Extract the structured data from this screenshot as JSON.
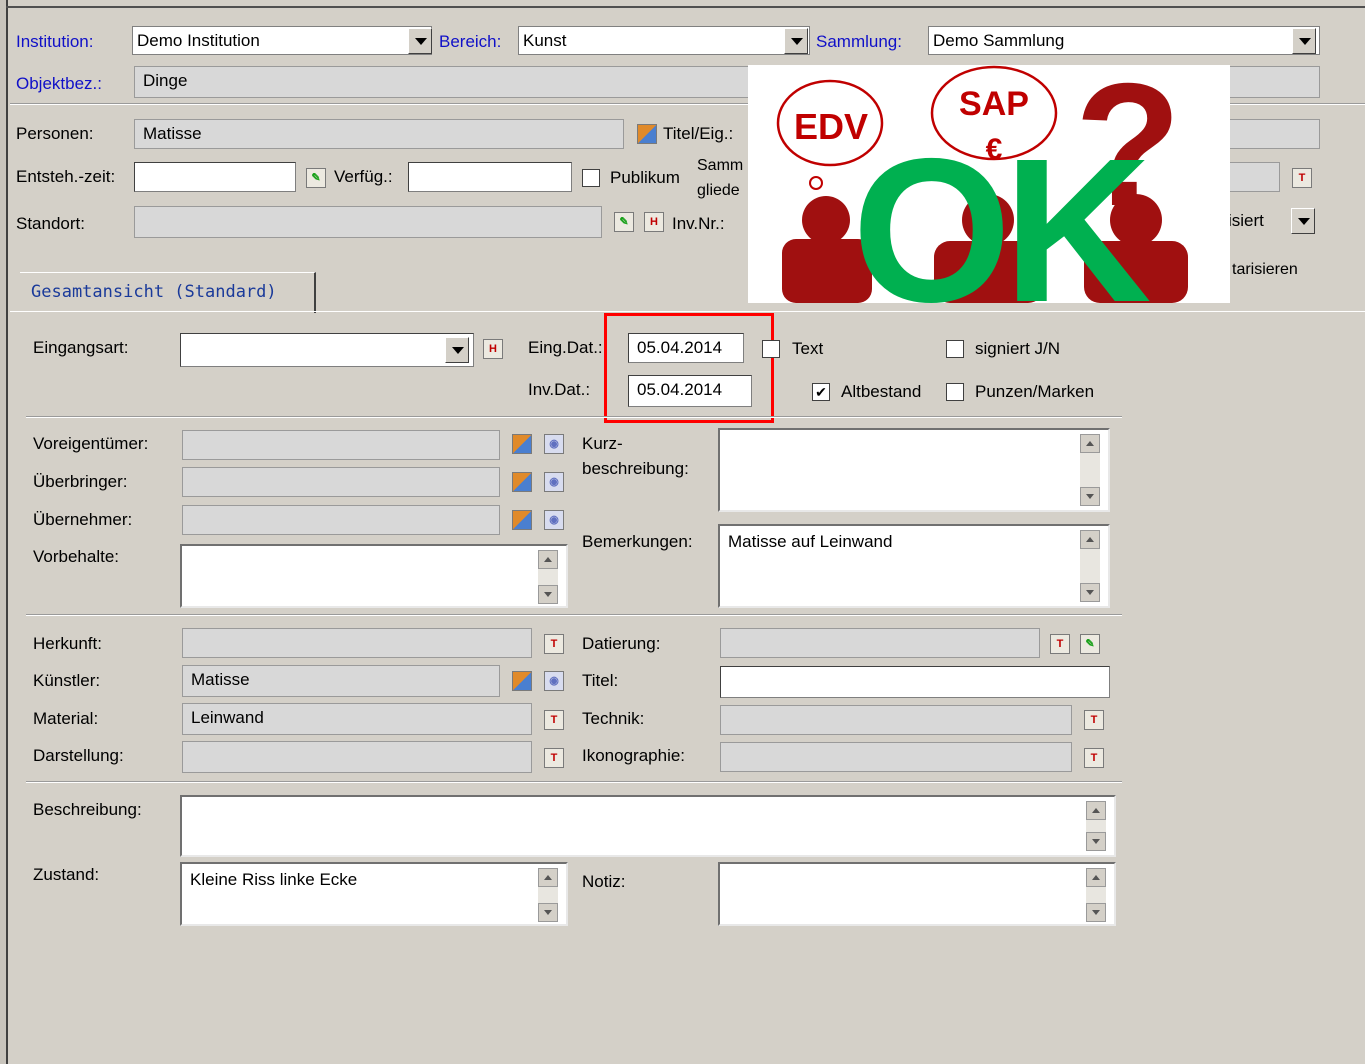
{
  "header": {
    "institution_label": "Institution:",
    "institution_value": "Demo Institution",
    "bereich_label": "Bereich:",
    "bereich_value": "Kunst",
    "sammlung_label": "Sammlung:",
    "sammlung_value": "Demo Sammlung",
    "objektbez_label": "Objektbez.:",
    "objektbez_value": "Dinge"
  },
  "top": {
    "personen_label": "Personen:",
    "personen_value": "Matisse",
    "titel_eig_label": "Titel/Eig.:",
    "entsteh_label": "Entsteh.-zeit:",
    "verfueg_label": "Verfüg.:",
    "publikum_label": "Publikum",
    "sammlung_glied_line1": "Samm",
    "sammlung_glied_line2": "gliede",
    "standort_label": "Standort:",
    "invnr_label": "Inv.Nr.:",
    "status_value": "isiert",
    "inventarisieren_label": "tarisieren"
  },
  "overlay": {
    "cloud1": "EDV",
    "cloud2_line1": "SAP",
    "cloud2_line2": "€",
    "ok": "OK",
    "question": "?"
  },
  "tab": {
    "label": "Gesamtansicht (Standard)"
  },
  "eingang": {
    "eingangsart_label": "Eingangsart:",
    "eingdat_label": "Eing.Dat.:",
    "eingdat_value": "05.04.2014",
    "invdat_label": "Inv.Dat.:",
    "invdat_value": "05.04.2014",
    "text_label": "Text",
    "signiert_label": "signiert J/N",
    "altbestand_label": "Altbestand",
    "punzen_label": "Punzen/Marken"
  },
  "owner": {
    "voreigentuemer_label": "Voreigentümer:",
    "ueberbringer_label": "Überbringer:",
    "uebernehmer_label": "Übernehmer:",
    "vorbehalte_label": "Vorbehalte:",
    "kurz_line1": "Kurz-",
    "kurz_line2": "beschreibung:",
    "bemerkungen_label": "Bemerkungen:",
    "bemerkungen_value": "Matisse auf Leinwand"
  },
  "details": {
    "herkunft_label": "Herkunft:",
    "datierung_label": "Datierung:",
    "kuenstler_label": "Künstler:",
    "kuenstler_value": "Matisse",
    "titel_label": "Titel:",
    "material_label": "Material:",
    "material_value": "Leinwand",
    "technik_label": "Technik:",
    "darstellung_label": "Darstellung:",
    "ikonographie_label": "Ikonographie:"
  },
  "description": {
    "beschreibung_label": "Beschreibung:",
    "zustand_label": "Zustand:",
    "zustand_value": "Kleine Riss linke Ecke",
    "notiz_label": "Notiz:"
  },
  "colors": {
    "highlight": "#ff0000",
    "ok": "#00b050",
    "figure": "#a01010",
    "cloud_text": "#c00000"
  }
}
